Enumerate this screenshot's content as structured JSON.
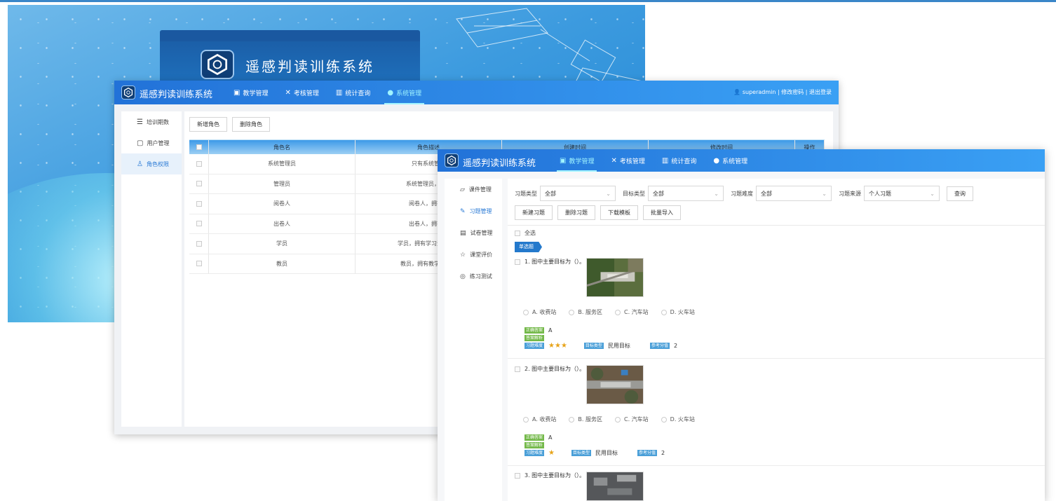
{
  "splash": {
    "title": "遥感判读训练系统"
  },
  "window2": {
    "app_title": "遥感判读训练系统",
    "nav": [
      {
        "label": "教学管理",
        "icon": "image-icon"
      },
      {
        "label": "考核管理",
        "icon": "tools-icon"
      },
      {
        "label": "统计查询",
        "icon": "bar-chart-icon"
      },
      {
        "label": "系统管理",
        "icon": "users-icon",
        "active": true
      }
    ],
    "user": {
      "name": "superadmin",
      "edit": "修改密码",
      "logout": "退出登录"
    },
    "sidebar": [
      {
        "label": "培训期数",
        "icon": "list-icon"
      },
      {
        "label": "用户管理",
        "icon": "user-card-icon"
      },
      {
        "label": "角色权限",
        "icon": "person-icon",
        "active": true
      }
    ],
    "buttons": {
      "add": "新增角色",
      "delete": "删除角色"
    },
    "table": {
      "headers": [
        "角色名",
        "角色描述",
        "创建时间",
        "修改时间",
        "操作"
      ],
      "rows": [
        {
          "name": "系统管理员",
          "desc": "只有系统管理"
        },
        {
          "name": "管理员",
          "desc": "系统管理员，拥有"
        },
        {
          "name": "阅卷人",
          "desc": "阅卷人，拥有判"
        },
        {
          "name": "出卷人",
          "desc": "出卷人，拥有命"
        },
        {
          "name": "学员",
          "desc": "学员，拥有学习资源，考"
        },
        {
          "name": "教员",
          "desc": "教员，拥有教学管理和"
        }
      ]
    }
  },
  "window3": {
    "app_title": "遥感判读训练系统",
    "nav": [
      {
        "label": "教学管理",
        "icon": "image-icon",
        "active": true
      },
      {
        "label": "考核管理",
        "icon": "tools-icon"
      },
      {
        "label": "统计查询",
        "icon": "bar-chart-icon"
      },
      {
        "label": "系统管理",
        "icon": "users-icon"
      }
    ],
    "sidebar": [
      {
        "label": "课件管理",
        "icon": "courseware-icon"
      },
      {
        "label": "习题管理",
        "icon": "exercise-icon",
        "active": true
      },
      {
        "label": "试卷管理",
        "icon": "paper-icon"
      },
      {
        "label": "课堂评价",
        "icon": "star-outline-icon"
      },
      {
        "label": "练习测试",
        "icon": "practice-icon"
      }
    ],
    "filters": [
      {
        "label": "习题类型",
        "value": "全部"
      },
      {
        "label": "目标类型",
        "value": "全部"
      },
      {
        "label": "习题难度",
        "value": "全部"
      },
      {
        "label": "习题来源",
        "value": "个人习题"
      }
    ],
    "query_button": "查询",
    "buttons": [
      "新建习题",
      "删除习题",
      "下载模板",
      "批量导入"
    ],
    "select_all": "全选",
    "type_tag": "单选题",
    "labels": {
      "answer": "正确答案",
      "analysis": "答案解析",
      "difficulty": "习题难度",
      "target_type": "目标类型",
      "score": "参考分值"
    },
    "questions": [
      {
        "title": "1. 图中主要目标为（）。",
        "options": [
          "A. 收费站",
          "B. 服务区",
          "C. 汽车站",
          "D. 火车站"
        ],
        "answer": "A",
        "stars": 3,
        "target": "民用目标",
        "score": "2"
      },
      {
        "title": "2. 图中主要目标为（）。",
        "options": [
          "A. 收费站",
          "B. 服务区",
          "C. 汽车站",
          "D. 火车站"
        ],
        "answer": "A",
        "stars": 1,
        "target": "民用目标",
        "score": "2"
      },
      {
        "title": "3. 图中主要目标为（）。"
      }
    ]
  }
}
